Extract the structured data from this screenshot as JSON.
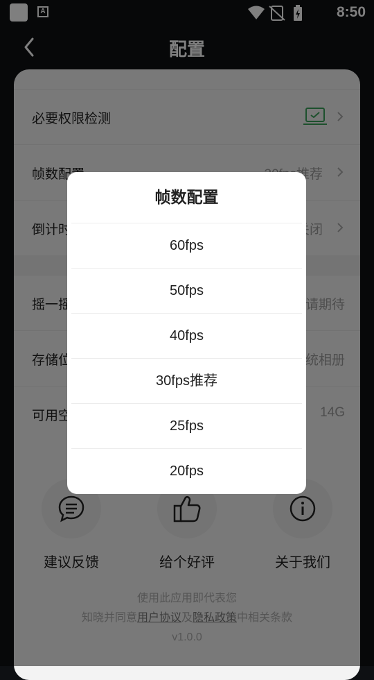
{
  "status_bar": {
    "time": "8:50",
    "notification_icon_letter": "A"
  },
  "header": {
    "title": "配置"
  },
  "settings": {
    "group1": [
      {
        "label": "必要权限检测",
        "value": "",
        "icon": "laptop-icon"
      },
      {
        "label": "帧数配置",
        "value": "30fps推荐"
      },
      {
        "label": "倒计时",
        "value": "关闭"
      }
    ],
    "group2": [
      {
        "label": "摇一摇",
        "value": "敬请期待"
      },
      {
        "label": "存储位置",
        "value": "系统相册"
      },
      {
        "label": "可用空间",
        "value": "14G"
      }
    ]
  },
  "actions": [
    {
      "label": "建议反馈",
      "icon": "chat-bubble-icon"
    },
    {
      "label": "给个好评",
      "icon": "thumbs-up-icon"
    },
    {
      "label": "关于我们",
      "icon": "info-icon"
    }
  ],
  "footer": {
    "line1": "使用此应用即代表您",
    "line2_prefix": "知晓并同意",
    "user_agreement": "用户协议",
    "and": "及",
    "privacy_policy": "隐私政策",
    "line2_suffix": "中相关条款",
    "version": "v1.0.0"
  },
  "dialog": {
    "title": "帧数配置",
    "options": [
      "60fps",
      "50fps",
      "40fps",
      "30fps推荐",
      "25fps",
      "20fps"
    ]
  },
  "colors": {
    "accent_green": "#3aa05a",
    "overlay": "rgba(0,0,0,0.5)"
  }
}
